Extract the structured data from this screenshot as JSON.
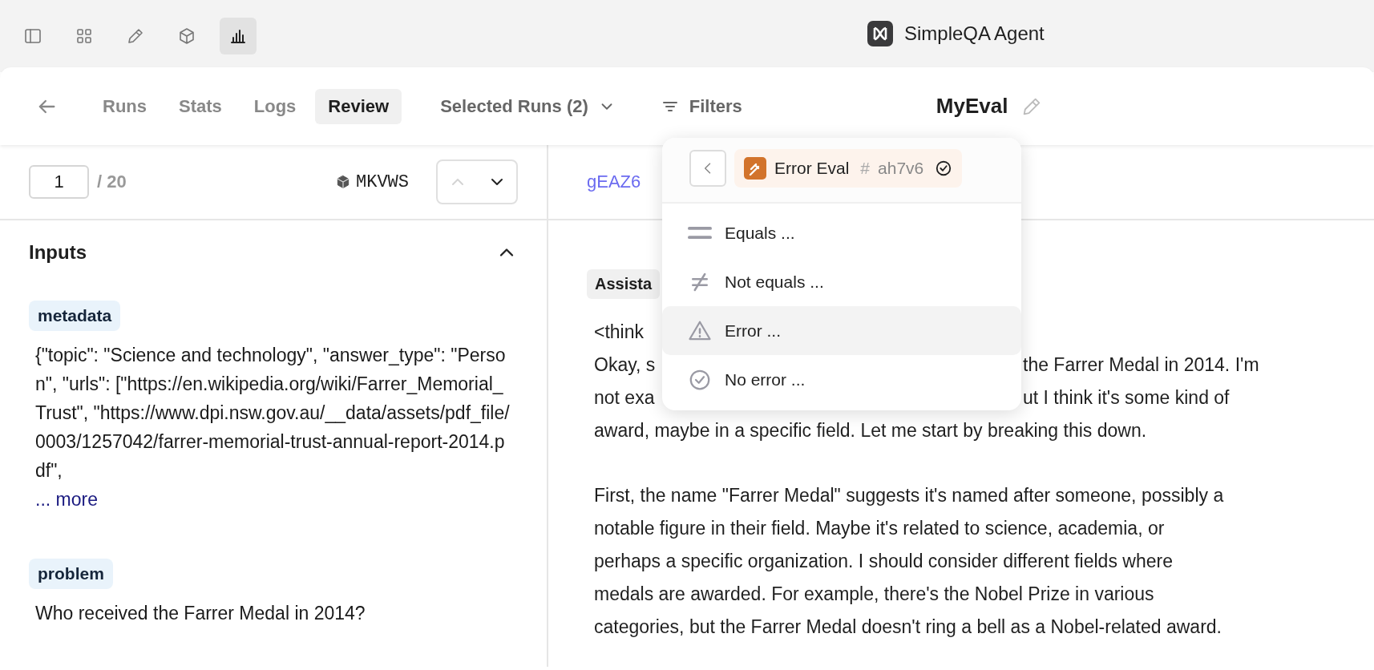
{
  "toolbar": {
    "icons": [
      {
        "kind": "sidebar",
        "selected": false
      },
      {
        "kind": "grid",
        "selected": false
      },
      {
        "kind": "pencil",
        "selected": false
      },
      {
        "kind": "cube",
        "selected": false
      },
      {
        "kind": "chart",
        "selected": true
      }
    ]
  },
  "app_title": "SimpleQA Agent",
  "nav": {
    "tabs": [
      {
        "label": "Runs",
        "selected": false
      },
      {
        "label": "Stats",
        "selected": false
      },
      {
        "label": "Logs",
        "selected": false
      },
      {
        "label": "Review",
        "selected": true
      }
    ],
    "selected_runs": "Selected Runs (2)",
    "filters": "Filters",
    "eval_name": "MyEval"
  },
  "pager": {
    "value": "1",
    "total": "/ 20",
    "sample_id": "MKVWS",
    "prev_disabled": true
  },
  "inputs": {
    "title": "Inputs",
    "expanded": true,
    "fields": [
      {
        "tag": "metadata",
        "text": "{\"topic\": \"Science and technology\", \"answer_type\": \"Person\", \"urls\": [\"https://en.wikipedia.org/wiki/Farrer_Memorial_Trust\", \"https://www.dpi.nsw.gov.au/__data/assets/pdf_file/0003/1257042/farrer-memorial-trust-annual-report-2014.pdf\",",
        "more": "... more"
      },
      {
        "tag": "problem",
        "text": "Who received the Farrer Medal in 2014?"
      }
    ]
  },
  "detail": {
    "id": "gEAZ6",
    "role": "Assista",
    "rows": [
      {
        "left": "<think"
      },
      {
        "left": "Okay, s",
        "right": "the Farrer Medal in 2014. I'm"
      },
      {
        "left": "not exa",
        "right": "ut I think it's some kind of"
      },
      {
        "left": "award, maybe in a specific field. Let me start by breaking this down."
      }
    ],
    "paragraphs": [
      "First, the name \"Farrer Medal\" suggests it's named after someone, possibly a notable figure in their field. Maybe it's related to science, academia, or perhaps a specific organization. I should consider different fields where medals are awarded. For example, there's the Nobel Prize in various categories, but the Farrer Medal doesn't ring a bell as a Nobel-related award."
    ]
  },
  "filter_menu": {
    "chip": {
      "name": "Error Eval",
      "hash": "#",
      "id": "ah7v6"
    },
    "options": [
      {
        "kind": "equals",
        "label": "Equals ...",
        "selected": false
      },
      {
        "kind": "not_equals",
        "label": "Not equals ...",
        "selected": false
      },
      {
        "kind": "error",
        "label": "Error ...",
        "selected": true
      },
      {
        "kind": "no_error",
        "label": "No error ...",
        "selected": false
      }
    ]
  }
}
